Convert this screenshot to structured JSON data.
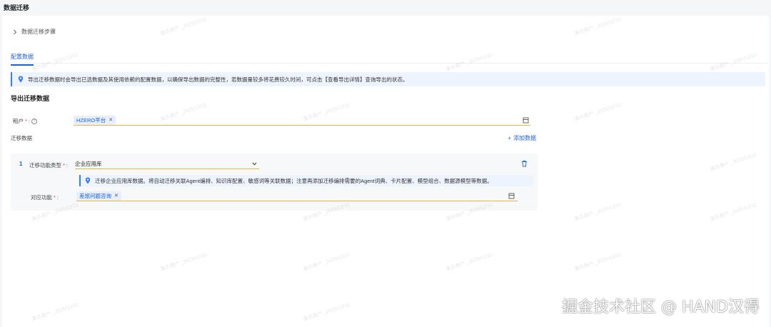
{
  "page_title": "数据迁移",
  "steps_toggle": "数据迁移步骤",
  "tab_label": "配置数据",
  "info_banner": "导出迁移数据时会导出已选数据及其使用依赖的配置数据，以确保导出数据的完整性，若数据量较多将花费较久时间，可点击【查看导出详情】查询导出的状态。",
  "section_title": "导出迁移数据",
  "tenant": {
    "label": "租户",
    "tag": "HZERO平台"
  },
  "migrate_data_label": "迁移数据",
  "add_data_label": "添加数据",
  "row": {
    "index": "1",
    "type_label": "迁移功能类型",
    "type_value": "企业应用库",
    "banner": "迁移企业应用库数据。将自动迁移关联Agent编排、知识库配置、敏感词等关联数据；注意再添加迁移编排需要的Agent词典、卡片配置、模型组合、数据源模型等数据。",
    "func_label": "对应功能",
    "func_tag": "差旅问题咨询"
  },
  "watermark_text": "演示用户 _2025/12/11",
  "brand_text": "掘金技术社区 @ HAND汉得",
  "colors": {
    "accent": "#1f5fd6",
    "required": "#e03e3e",
    "focus_border": "#e8b44a",
    "banner_bg": "#eef4fe"
  }
}
